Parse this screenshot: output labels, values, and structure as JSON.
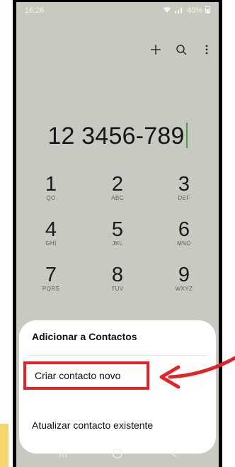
{
  "status": {
    "time": "16:26",
    "battery": "40%"
  },
  "toolbar": {
    "add_icon": "plus-icon",
    "search_icon": "search-icon",
    "more_icon": "more-vert-icon"
  },
  "dialed_number": "12 3456-789",
  "keypad": [
    {
      "digit": "1",
      "letters": "QO"
    },
    {
      "digit": "2",
      "letters": "ABC"
    },
    {
      "digit": "3",
      "letters": "DEF"
    },
    {
      "digit": "4",
      "letters": "GHI"
    },
    {
      "digit": "5",
      "letters": "JKL"
    },
    {
      "digit": "6",
      "letters": "MNO"
    },
    {
      "digit": "7",
      "letters": "PQRS"
    },
    {
      "digit": "8",
      "letters": "TUV"
    },
    {
      "digit": "9",
      "letters": "WXYZ"
    }
  ],
  "sheet": {
    "title": "Adicionar a Contactos",
    "option_new": "Criar contacto novo",
    "option_existing": "Atualizar contacto existente"
  },
  "colors": {
    "highlight_red": "#e1232a",
    "screen_bg": "#c8c9c1",
    "accent_yellow": "#f6d66a"
  }
}
